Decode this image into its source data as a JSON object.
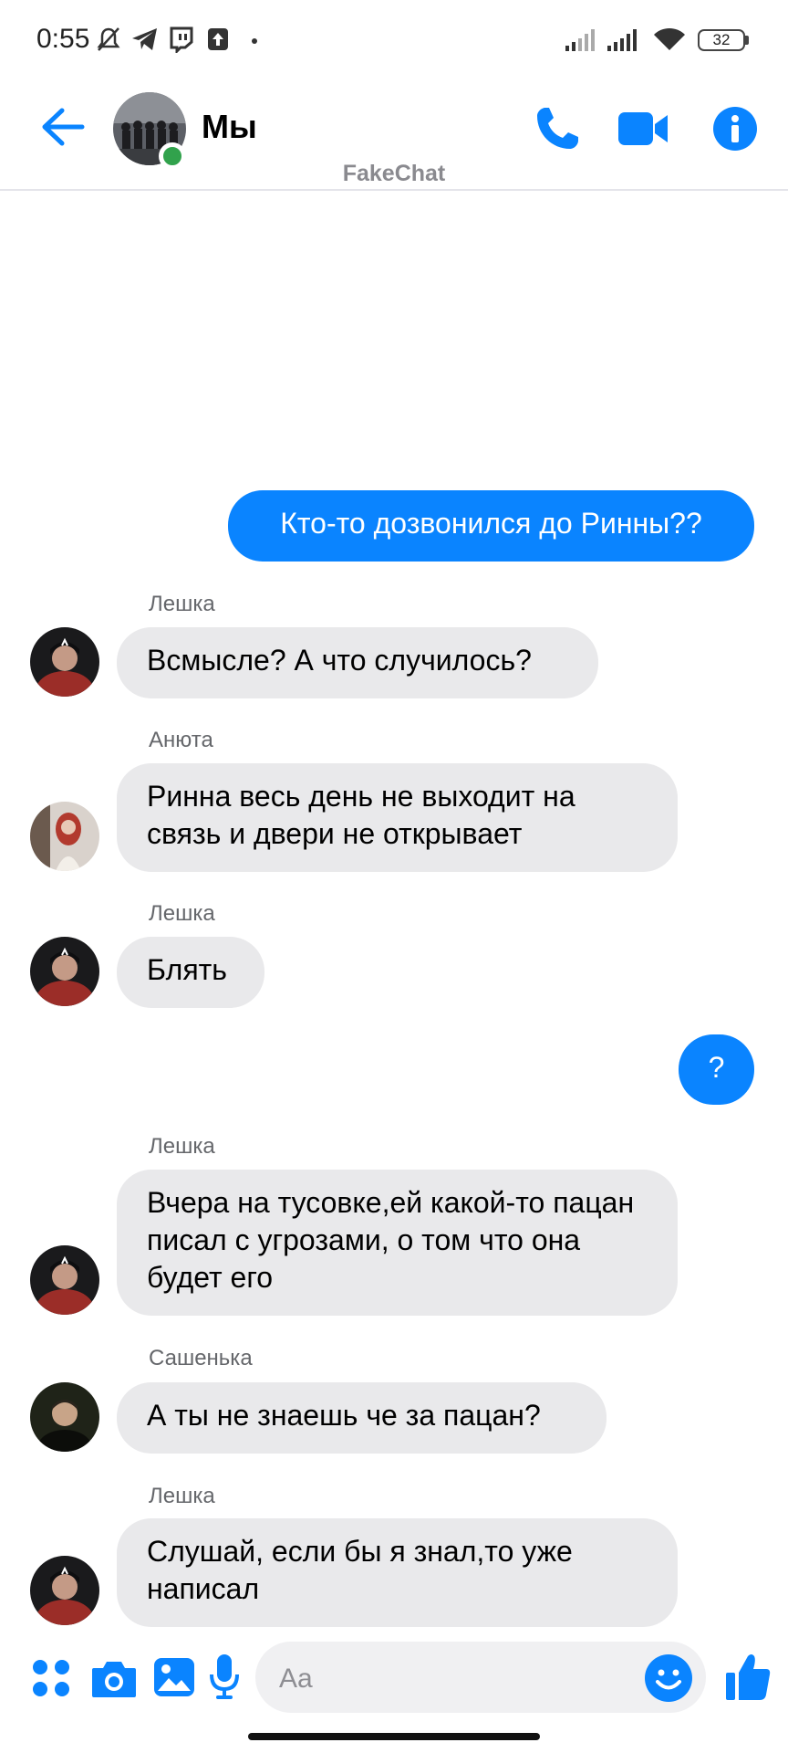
{
  "status_bar": {
    "time": "0:55",
    "battery": "32",
    "icons": [
      "muted-bell-icon",
      "telegram-icon",
      "twitch-icon",
      "upload-icon",
      "dot-icon",
      "signal-icon",
      "signal-icon",
      "wifi-icon",
      "battery-icon"
    ]
  },
  "header": {
    "title": "Мы",
    "online": true,
    "icons": [
      "back-arrow-icon",
      "phone-icon",
      "video-icon",
      "info-icon"
    ],
    "accent_color": "#0a84ff"
  },
  "watermark": "FakeChat",
  "messages": [
    {
      "direction": "out",
      "text": "Кто-то дозвонился до Ринны??"
    },
    {
      "direction": "in",
      "sender": "Лешка",
      "text": "Всмысле? А что случилось?"
    },
    {
      "direction": "in",
      "sender": "Анюта",
      "text": "Ринна весь день не выходит на связь и двери не открывает"
    },
    {
      "direction": "in",
      "sender": "Лешка",
      "text": "Блять"
    },
    {
      "direction": "out",
      "text": "?"
    },
    {
      "direction": "in",
      "sender": "Лешка",
      "text": "Вчера на тусовке,ей какой-то пацан писал с угрозами, о том что она будет его"
    },
    {
      "direction": "in",
      "sender": "Сашенька",
      "text": "А ты не знаешь че за пацан?"
    },
    {
      "direction": "in",
      "sender": "Лешка",
      "text": "Слушай, если бы я знал,то уже написал"
    }
  ],
  "composer": {
    "placeholder": "Aa",
    "icons": [
      "menu-grid-icon",
      "camera-icon",
      "gallery-icon",
      "microphone-icon",
      "emoji-icon",
      "thumbs-up-icon"
    ]
  }
}
